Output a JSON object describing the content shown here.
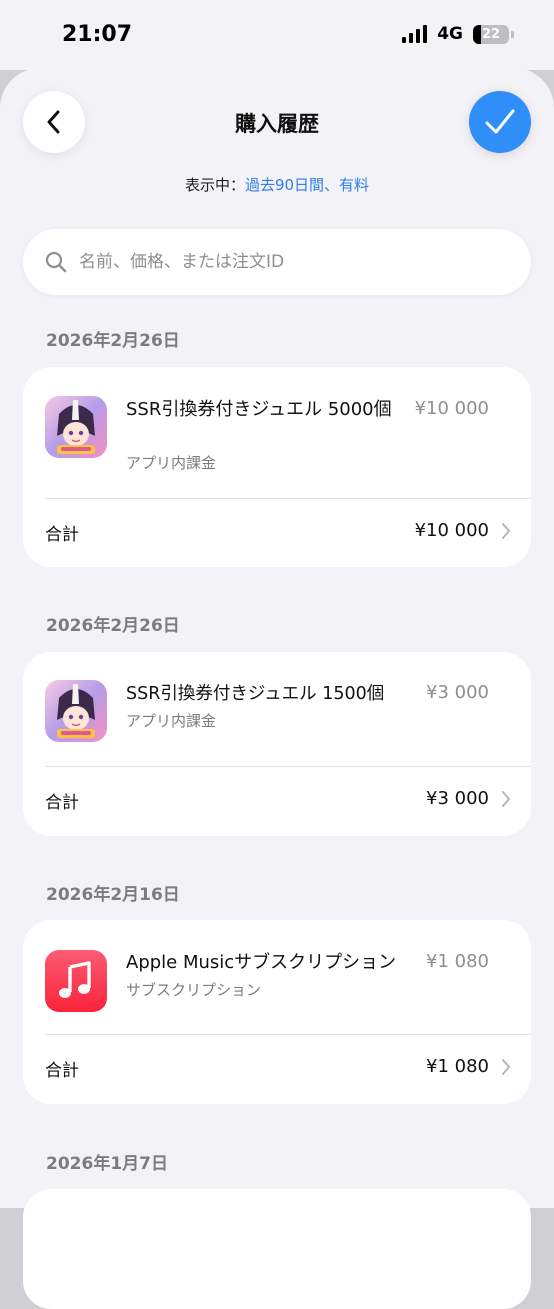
{
  "status": {
    "time": "21:07",
    "network": "4G",
    "battery": "22"
  },
  "header": {
    "title": "購入履歴"
  },
  "filter": {
    "prefix": "表示中：",
    "value": "過去90日間、有料"
  },
  "search": {
    "placeholder": "名前、価格、または注文ID"
  },
  "groups": [
    {
      "date": "2026年2月26日",
      "item": {
        "name": "SSR引換券付きジュエル 5000個",
        "type": "アプリ内課金",
        "price": "¥10 000"
      },
      "total_label": "合計",
      "total": "¥10 000"
    },
    {
      "date": "2026年2月26日",
      "item": {
        "name": "SSR引換券付きジュエル 1500個",
        "type": "アプリ内課金",
        "price": "¥3 000"
      },
      "total_label": "合計",
      "total": "¥3 000"
    },
    {
      "date": "2026年2月16日",
      "item": {
        "name": "Apple Musicサブスクリプション",
        "type": "サブスクリプション",
        "price": "¥1 080"
      },
      "total_label": "合計",
      "total": "¥1 080"
    },
    {
      "date": "2026年1月7日"
    }
  ],
  "colors": {
    "accent": "#2f8ef7",
    "link": "#2f7fe6",
    "music": "#fc3c44"
  },
  "icons": [
    "back-chevron-icon",
    "checkmark-icon",
    "search-icon",
    "game-app-icon",
    "apple-music-icon",
    "chevron-right-icon"
  ]
}
